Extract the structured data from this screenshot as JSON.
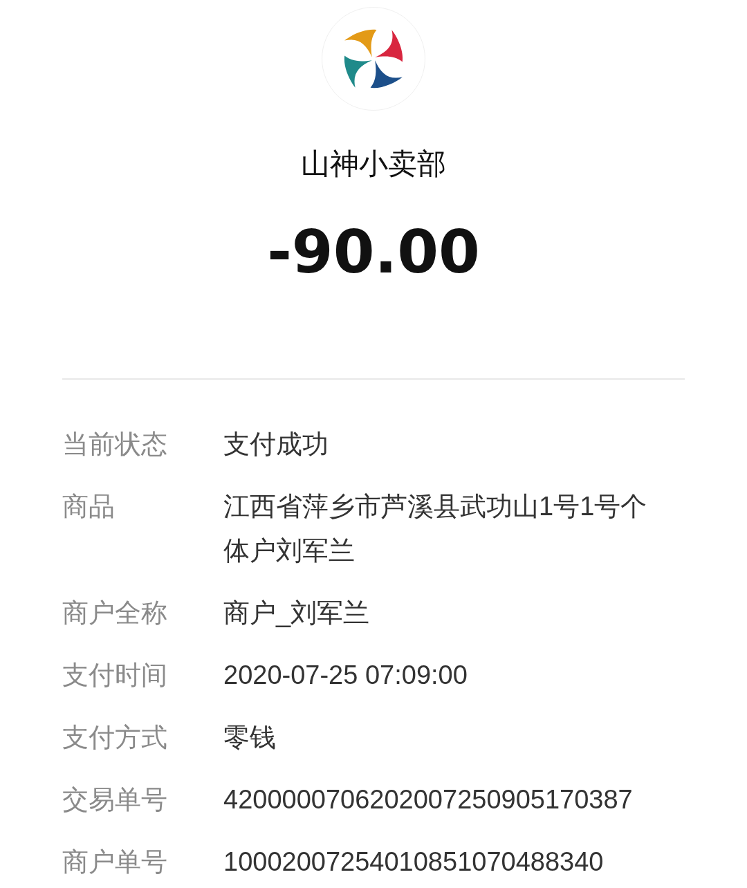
{
  "merchant": {
    "name": "山神小卖部"
  },
  "amount": "-90.00",
  "details": [
    {
      "label": "当前状态",
      "value": "支付成功"
    },
    {
      "label": "商品",
      "value": "江西省萍乡市芦溪县武功山1号1号个体户刘军兰"
    },
    {
      "label": "商户全称",
      "value": "商户_刘军兰"
    },
    {
      "label": "支付时间",
      "value": "2020-07-25 07:09:00"
    },
    {
      "label": "支付方式",
      "value": "零钱"
    },
    {
      "label": "交易单号",
      "value": "4200000706202007250905170387"
    },
    {
      "label": "商户单号",
      "value": "10002007254010851070488340"
    }
  ]
}
